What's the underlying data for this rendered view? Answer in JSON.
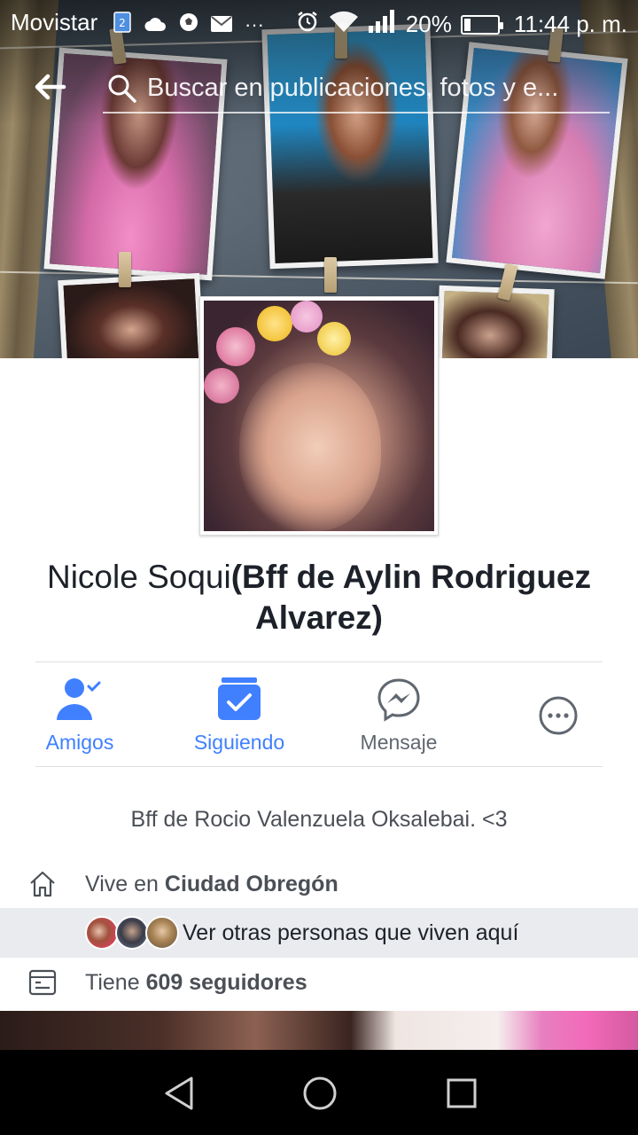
{
  "status_bar": {
    "carrier": "Movistar",
    "battery": "20%",
    "battery_level": 0.2,
    "time": "11:44 p. m.",
    "left_icons": [
      "sim-icon",
      "cloud-icon",
      "soccer-icon",
      "mail-icon",
      "more-dots-icon"
    ],
    "right_icons": [
      "alarm-icon",
      "wifi-icon",
      "signal-icon",
      "battery-icon"
    ]
  },
  "search": {
    "placeholder": "Buscar en publicaciones, fotos y e..."
  },
  "profile": {
    "name": "Nicole Soqui",
    "alternate_name": "(Bff de Aylin Rodriguez Alvarez)"
  },
  "actions": [
    {
      "label": "Amigos",
      "icon": "friends-check-icon",
      "color": "#4080ff"
    },
    {
      "label": "Siguiendo",
      "icon": "following-check-icon",
      "color": "#4080ff"
    },
    {
      "label": "Mensaje",
      "icon": "messenger-icon",
      "color": "#606770"
    },
    {
      "label": "",
      "icon": "more-icon",
      "color": "#606770"
    }
  ],
  "intro": {
    "bio": "Bff de Rocio Valenzuela Oksalebai. <3",
    "lives_in_prefix": "Vive en ",
    "lives_in_city": "Ciudad Obregón",
    "see_others": "Ver otras personas que viven aquí",
    "followers_prefix": "Tiene ",
    "followers_count": "609 seguidores"
  },
  "colors": {
    "accent": "#4080ff",
    "text": "#1d2129",
    "secondary_text": "#4b4f56",
    "highlight_row": "#e9ebee"
  }
}
